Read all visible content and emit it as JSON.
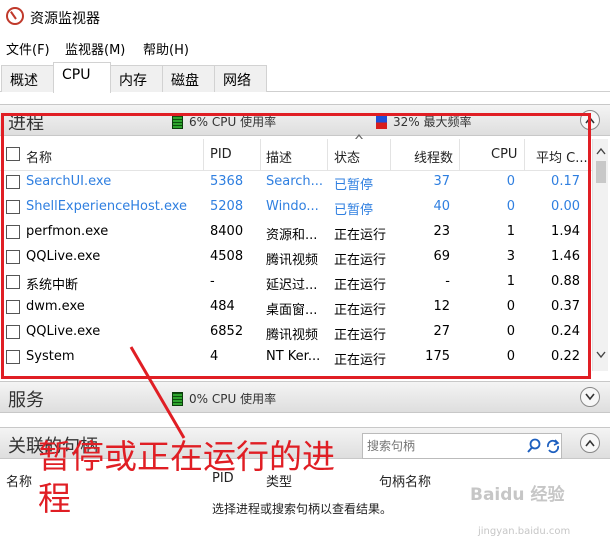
{
  "window": {
    "title": "资源监视器"
  },
  "menu": [
    "文件(F)",
    "监视器(M)",
    "帮助(H)"
  ],
  "tabs": [
    "概述",
    "CPU",
    "内存",
    "磁盘",
    "网络"
  ],
  "active_tab": "CPU",
  "processes": {
    "title": "进程",
    "cpu_usage": "6% CPU 使用率",
    "max_freq": "32% 最大频率",
    "columns": {
      "name": "名称",
      "pid": "PID",
      "desc": "描述",
      "status": "状态",
      "threads": "线程数",
      "cpu": "CPU",
      "avgcpu": "平均 C..."
    },
    "rows": [
      {
        "name": "SearchUI.exe",
        "pid": "5368",
        "desc": "Search...",
        "status": "已暂停",
        "threads": "37",
        "cpu": "0",
        "avgcpu": "0.17",
        "suspended": true
      },
      {
        "name": "ShellExperienceHost.exe",
        "pid": "5208",
        "desc": "Windo...",
        "status": "已暂停",
        "threads": "40",
        "cpu": "0",
        "avgcpu": "0.00",
        "suspended": true
      },
      {
        "name": "perfmon.exe",
        "pid": "8400",
        "desc": "资源和...",
        "status": "正在运行",
        "threads": "23",
        "cpu": "1",
        "avgcpu": "1.94",
        "suspended": false
      },
      {
        "name": "QQLive.exe",
        "pid": "4508",
        "desc": "腾讯视频",
        "status": "正在运行",
        "threads": "69",
        "cpu": "3",
        "avgcpu": "1.46",
        "suspended": false
      },
      {
        "name": "系统中断",
        "pid": "-",
        "desc": "延迟过...",
        "status": "正在运行",
        "threads": "-",
        "cpu": "1",
        "avgcpu": "0.88",
        "suspended": false
      },
      {
        "name": "dwm.exe",
        "pid": "484",
        "desc": "桌面窗...",
        "status": "正在运行",
        "threads": "12",
        "cpu": "0",
        "avgcpu": "0.37",
        "suspended": false
      },
      {
        "name": "QQLive.exe",
        "pid": "6852",
        "desc": "腾讯视频",
        "status": "正在运行",
        "threads": "27",
        "cpu": "0",
        "avgcpu": "0.24",
        "suspended": false
      },
      {
        "name": "System",
        "pid": "4",
        "desc": "NT Ker...",
        "status": "正在运行",
        "threads": "175",
        "cpu": "0",
        "avgcpu": "0.22",
        "suspended": false
      }
    ]
  },
  "services": {
    "title": "服务",
    "cpu_usage": "0% CPU 使用率"
  },
  "handles": {
    "title": "关联的句柄",
    "search_placeholder": "搜索句柄",
    "columns": {
      "name": "名称",
      "pid": "PID",
      "type": "类型",
      "handle_name": "句柄名称"
    },
    "empty_message": "选择进程或搜索句柄以查看结果。"
  },
  "annotation": {
    "line1": "暂停或正在运行的进",
    "line2": "程"
  },
  "watermark": {
    "brand": "Baidu 经验",
    "url": "jingyan.baidu.com"
  },
  "colors": {
    "suspended_text": "#2f7fe0",
    "annotation_red": "#e01e24"
  }
}
